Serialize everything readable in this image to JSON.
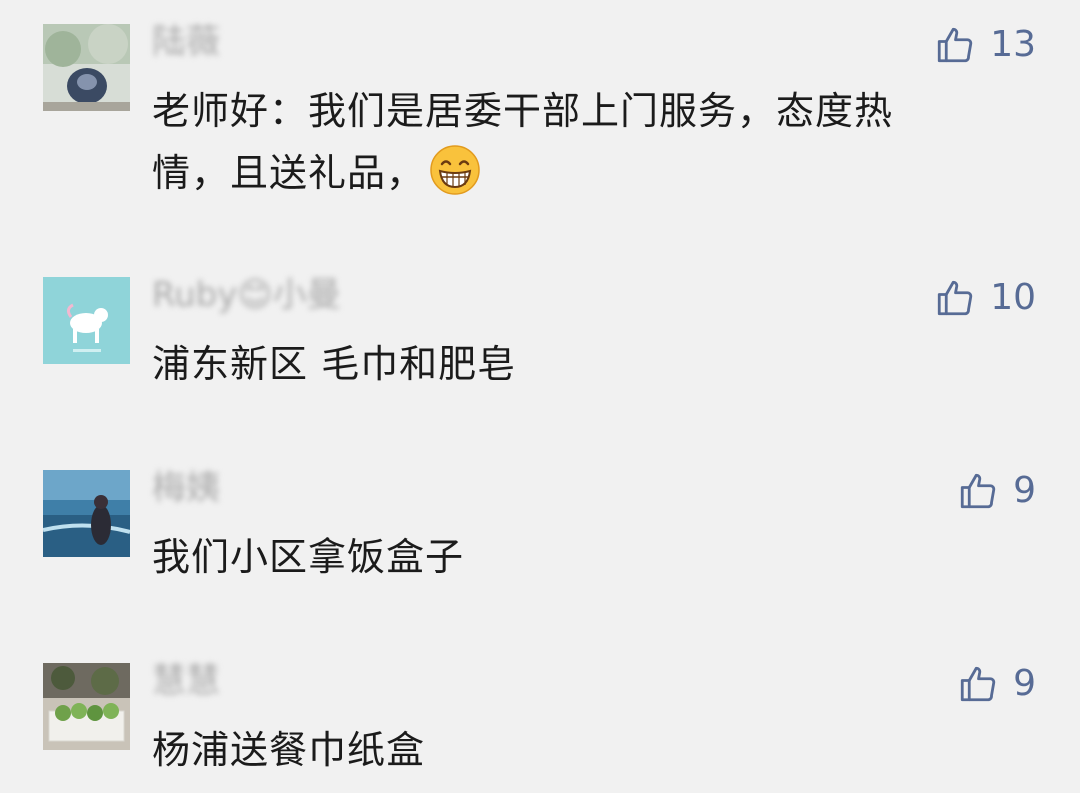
{
  "comments": [
    {
      "nickname": "陆薇",
      "text_line1": "老师好：我们是居委干部上门服务，态度热",
      "text_line2": "情，且送礼品，",
      "emoji": "grin-emoji",
      "likes": "13"
    },
    {
      "nickname": "Ruby😊小曼",
      "text": "浦东新区 毛巾和肥皂",
      "likes": "10"
    },
    {
      "nickname": "梅姨",
      "text": "我们小区拿饭盒子",
      "likes": "9"
    },
    {
      "nickname": "慧慧",
      "text": "杨浦送餐巾纸盒",
      "likes": "9"
    }
  ],
  "like_color": "#576b95"
}
